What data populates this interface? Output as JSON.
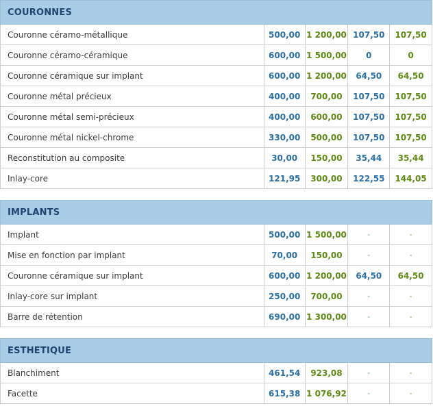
{
  "sections": [
    {
      "title": "COURONNES",
      "rows": [
        {
          "label": "Couronne céramo-métallique",
          "v1": "500,00",
          "v2": "1 200,00",
          "v3": "107,50",
          "v4": "107,50"
        },
        {
          "label": "Couronne céramo-céramique",
          "v1": "600,00",
          "v2": "1 500,00",
          "v3": "0",
          "v4": "0"
        },
        {
          "label": "Couronne céramique sur implant",
          "v1": "600,00",
          "v2": "1 200,00",
          "v3": "64,50",
          "v4": "64,50"
        },
        {
          "label": "Couronne métal précieux",
          "v1": "400,00",
          "v2": "700,00",
          "v3": "107,50",
          "v4": "107,50"
        },
        {
          "label": "Couronne métal semi-précieux",
          "v1": "400,00",
          "v2": "600,00",
          "v3": "107,50",
          "v4": "107,50"
        },
        {
          "label": "Couronne métal nickel-chrome",
          "v1": "330,00",
          "v2": "500,00",
          "v3": "107,50",
          "v4": "107,50"
        },
        {
          "label": "Reconstitution au composite",
          "v1": "30,00",
          "v2": "150,00",
          "v3": "35,44",
          "v4": "35,44"
        },
        {
          "label": "Inlay-core",
          "v1": "121,95",
          "v2": "300,00",
          "v3": "122,55",
          "v4": "144,05"
        }
      ]
    },
    {
      "title": "IMPLANTS",
      "rows": [
        {
          "label": "Implant",
          "v1": "500,00",
          "v2": "1 500,00",
          "v3": "-",
          "v4": "-"
        },
        {
          "label": "Mise en fonction par implant",
          "v1": "70,00",
          "v2": "150,00",
          "v3": "-",
          "v4": "-"
        },
        {
          "label": "Couronne céramique sur implant",
          "v1": "600,00",
          "v2": "1 200,00",
          "v3": "64,50",
          "v4": "64,50"
        },
        {
          "label": "Inlay-core sur implant",
          "v1": "250,00",
          "v2": "700,00",
          "v3": "-",
          "v4": "-"
        },
        {
          "label": "Barre de rétention",
          "v1": "690,00",
          "v2": "1 300,00",
          "v3": "-",
          "v4": "-"
        }
      ]
    },
    {
      "title": "ESTHETIQUE",
      "rows": [
        {
          "label": "Blanchiment",
          "v1": "461,54",
          "v2": "923,08",
          "v3": "-",
          "v4": "-"
        },
        {
          "label": "Facette",
          "v1": "615,38",
          "v2": "1 076,92",
          "v3": "-",
          "v4": "-"
        }
      ]
    }
  ]
}
